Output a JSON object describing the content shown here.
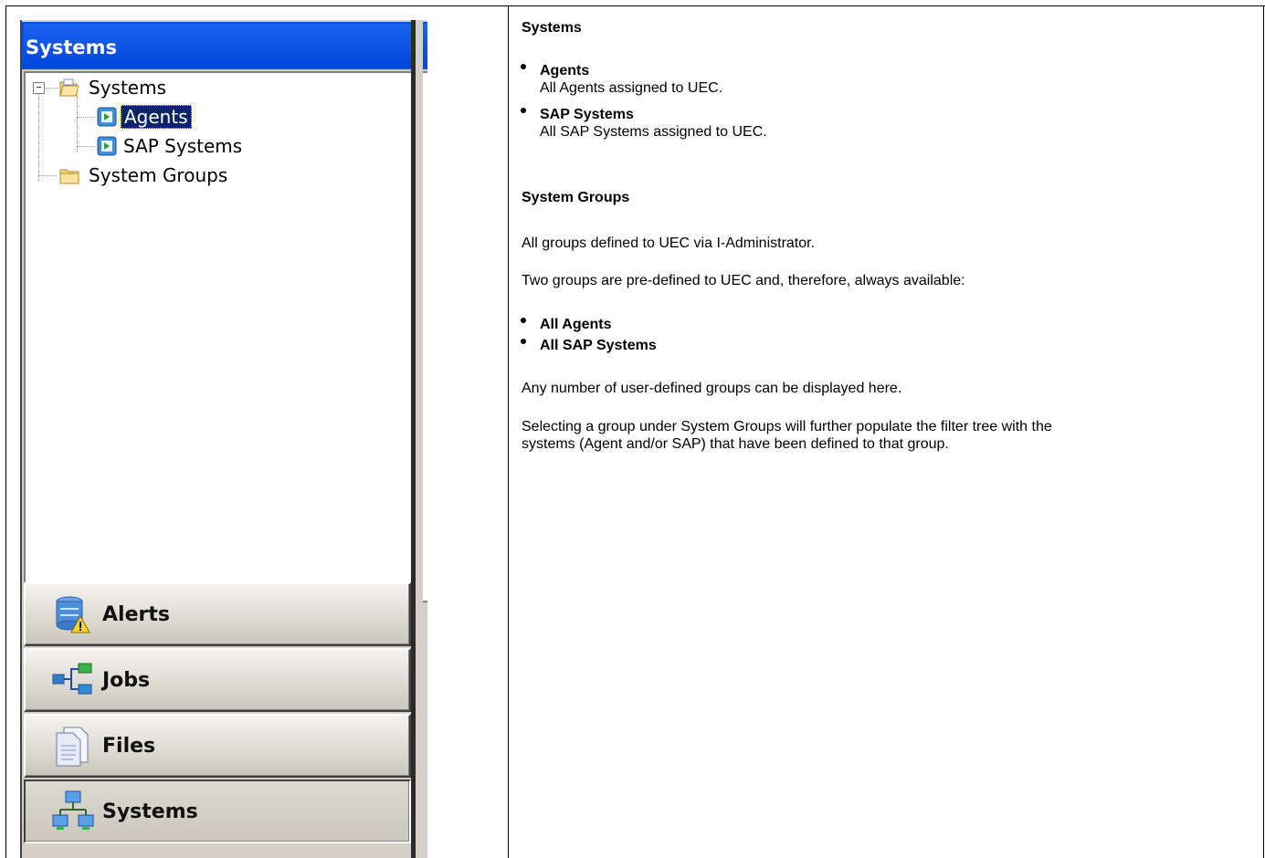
{
  "navigator": {
    "title": "Systems",
    "tree": [
      {
        "label": "Systems",
        "type": "folder-open"
      },
      {
        "label": "Agents",
        "type": "system",
        "selected": true
      },
      {
        "label": "SAP Systems",
        "type": "system"
      },
      {
        "label": "System Groups",
        "type": "folder"
      }
    ],
    "buttons": [
      {
        "label": "Alerts",
        "icon": "alerts-icon"
      },
      {
        "label": "Jobs",
        "icon": "jobs-icon"
      },
      {
        "label": "Files",
        "icon": "files-icon"
      },
      {
        "label": "Systems",
        "icon": "systems-icon"
      }
    ],
    "header_color": "#0a50e0"
  },
  "description": {
    "systems_heading": "Systems",
    "systems_items": [
      {
        "title": "Agents",
        "text": "All Agents assigned to UEC."
      },
      {
        "title": "SAP Systems",
        "text": "All SAP Systems assigned to UEC."
      }
    ],
    "groups_heading": "System Groups",
    "groups_para1": "All groups defined to UEC via I-Administrator.",
    "groups_para2": "Two groups are pre-defined to UEC and, therefore, always available:",
    "groups_items": [
      "All Agents",
      "All SAP Systems"
    ],
    "groups_para3": "Any number of user-defined groups can be displayed here.",
    "groups_para4_line1": "Selecting a group under System Groups will further populate the filter tree with the",
    "groups_para4_line2": "systems (Agent and/or SAP) that have been defined to that group."
  }
}
